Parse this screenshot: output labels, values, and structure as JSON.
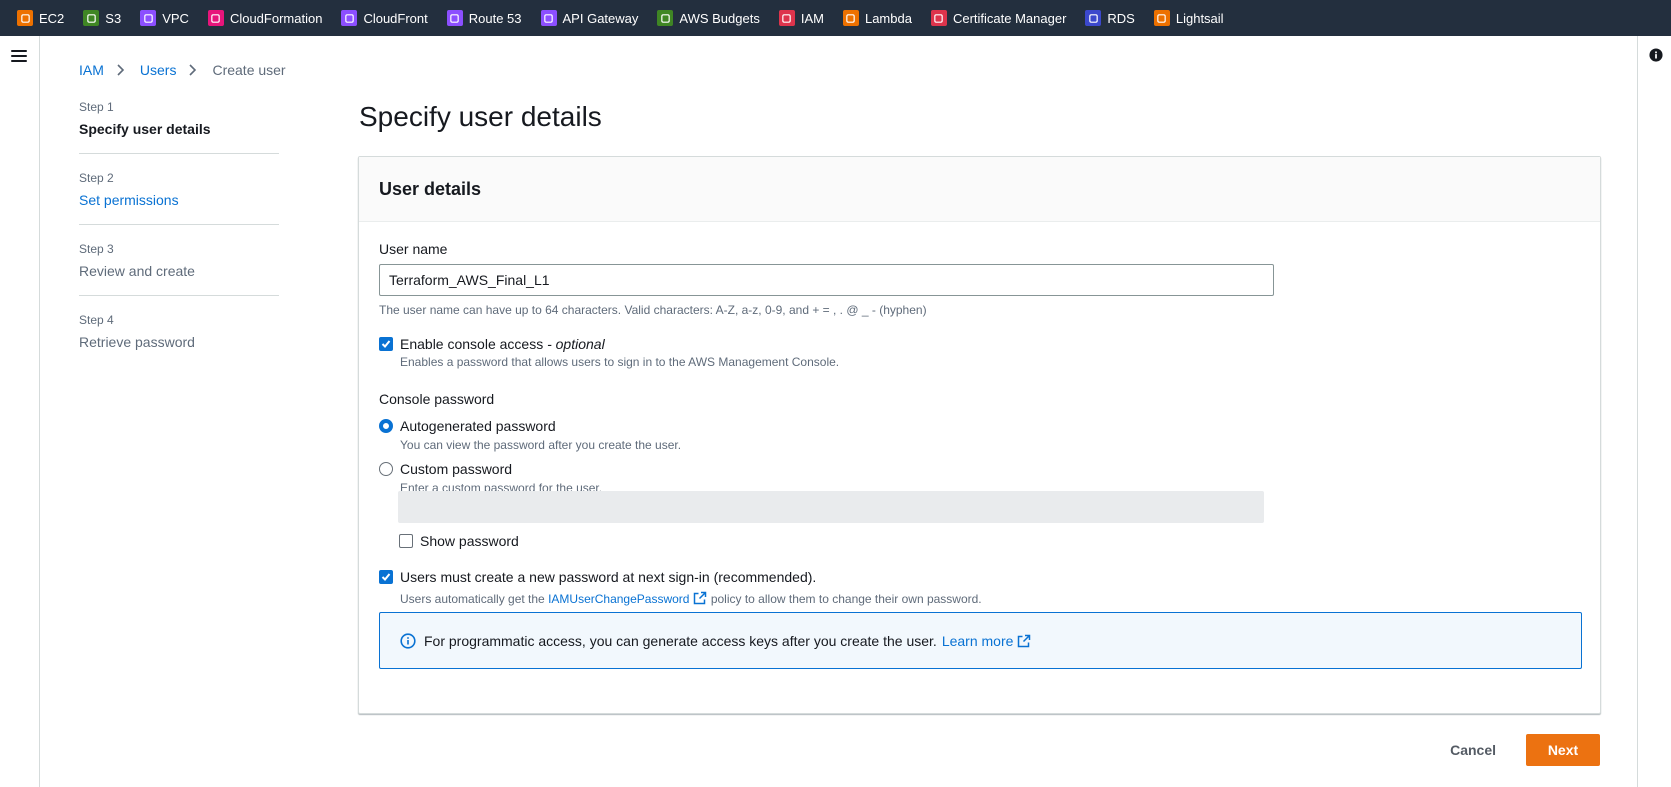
{
  "services": [
    {
      "label": "EC2",
      "icon": "ec2-icon",
      "color": "#ed7100"
    },
    {
      "label": "S3",
      "icon": "s3-icon",
      "color": "#3f8624"
    },
    {
      "label": "VPC",
      "icon": "vpc-icon",
      "color": "#8c4fff"
    },
    {
      "label": "CloudFormation",
      "icon": "cloudformation-icon",
      "color": "#e7157b"
    },
    {
      "label": "CloudFront",
      "icon": "cloudfront-icon",
      "color": "#8c4fff"
    },
    {
      "label": "Route 53",
      "icon": "route53-icon",
      "color": "#8c4fff"
    },
    {
      "label": "API Gateway",
      "icon": "api-gateway-icon",
      "color": "#8c4fff"
    },
    {
      "label": "AWS Budgets",
      "icon": "aws-budgets-icon",
      "color": "#3f8624"
    },
    {
      "label": "IAM",
      "icon": "iam-icon",
      "color": "#dd344c"
    },
    {
      "label": "Lambda",
      "icon": "lambda-icon",
      "color": "#ed7100"
    },
    {
      "label": "Certificate Manager",
      "icon": "certificate-manager-icon",
      "color": "#dd344c"
    },
    {
      "label": "RDS",
      "icon": "rds-icon",
      "color": "#3b48cc"
    },
    {
      "label": "Lightsail",
      "icon": "lightsail-icon",
      "color": "#ed7100"
    }
  ],
  "breadcrumb": {
    "iam": "IAM",
    "users": "Users",
    "current": "Create user"
  },
  "steps": [
    {
      "num": "Step 1",
      "title": "Specify user details"
    },
    {
      "num": "Step 2",
      "title": "Set permissions"
    },
    {
      "num": "Step 3",
      "title": "Review and create"
    },
    {
      "num": "Step 4",
      "title": "Retrieve password"
    }
  ],
  "page_title": "Specify user details",
  "form": {
    "section_title": "User details",
    "user_name_label": "User name",
    "user_name_value": "Terraform_AWS_Final_L1",
    "user_name_hint": "The user name can have up to 64 characters. Valid characters: A-Z, a-z, 0-9, and + = , . @ _ - (hyphen)",
    "console_access_label": "Enable console access",
    "console_access_optional": "- optional",
    "console_access_hint": "Enables a password that allows users to sign in to the AWS Management Console.",
    "console_password_label": "Console password",
    "autogen_label": "Autogenerated password",
    "autogen_hint": "You can view the password after you create the user.",
    "custom_label": "Custom password",
    "custom_hint": "Enter a custom password for the user.",
    "show_password_label": "Show password",
    "reset_label": "Users must create a new password at next sign-in (recommended).",
    "reset_hint_before": "Users automatically get the",
    "reset_hint_link": "IAMUserChangePassword",
    "reset_hint_after": "policy to allow them to change their own password.",
    "info_text": "For programmatic access, you can generate access keys after you create the user.",
    "info_link": "Learn more"
  },
  "actions": {
    "cancel": "Cancel",
    "next": "Next"
  },
  "colors": {
    "accent": "#0972d3",
    "primary_button": "#ec7211",
    "topbar": "#232f3e"
  }
}
